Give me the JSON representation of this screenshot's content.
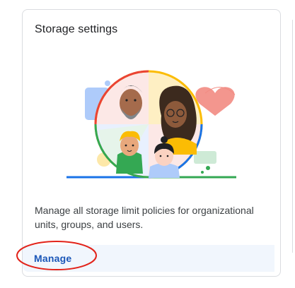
{
  "card": {
    "title": "Storage settings",
    "description": "Manage all storage limit policies for organizational units, groups, and users.",
    "action_label": "Manage"
  },
  "colors": {
    "accent_link": "#1a56b8",
    "annotation": "#e2231a",
    "action_bar_bg": "#f1f6fd",
    "border": "#dadce0"
  },
  "icons": {
    "illustration": "people-storage-illustration",
    "annotation": "red-ellipse-annotation"
  }
}
